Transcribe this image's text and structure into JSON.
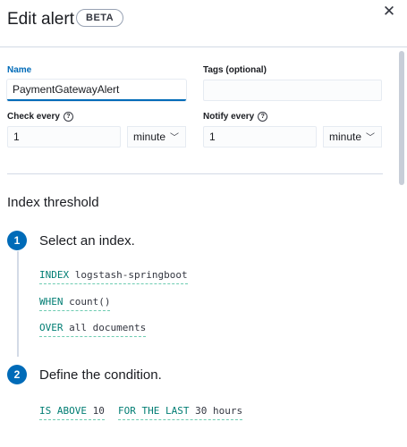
{
  "header": {
    "title": "Edit alert",
    "badge": "BETA",
    "close_icon": "close-icon"
  },
  "form": {
    "name": {
      "label": "Name",
      "value": "PaymentGatewayAlert"
    },
    "tags": {
      "label": "Tags (optional)",
      "value": ""
    },
    "check_every": {
      "label": "Check every",
      "value": "1",
      "unit": "minute"
    },
    "notify_every": {
      "label": "Notify every",
      "value": "1",
      "unit": "minute"
    }
  },
  "section": {
    "title": "Index threshold"
  },
  "steps": [
    {
      "number": "1",
      "title": "Select an index.",
      "expressions": [
        {
          "keyword": "INDEX",
          "value": "logstash-springboot"
        },
        {
          "keyword": "WHEN",
          "value": "count()"
        },
        {
          "keyword": "OVER",
          "value": "all documents"
        }
      ]
    },
    {
      "number": "2",
      "title": "Define the condition.",
      "expressions": [
        {
          "keyword": "IS ABOVE",
          "value": "10"
        },
        {
          "keyword": "FOR THE LAST",
          "value": "30 hours"
        }
      ]
    }
  ],
  "colors": {
    "primary": "#006bb8",
    "keyword": "#017d73",
    "border": "#d3dae6"
  }
}
